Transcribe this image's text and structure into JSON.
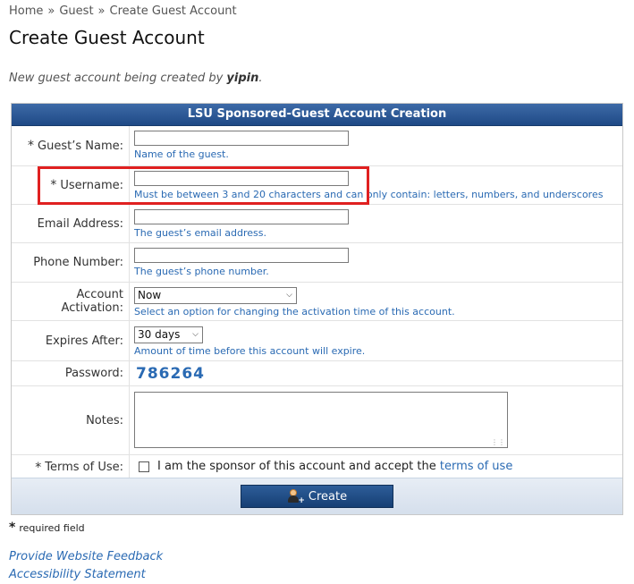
{
  "breadcrumb": [
    "Home",
    "Guest",
    "Create Guest Account"
  ],
  "breadcrumb_separator": "»",
  "page_title": "Create Guest Account",
  "subtitle": {
    "prefix": "New guest account being created by ",
    "user": "yipin",
    "suffix": "."
  },
  "form": {
    "header": "LSU Sponsored-Guest Account Creation",
    "required_marker": "*",
    "fields": {
      "guest_name": {
        "label": "Guest’s Name:",
        "value": "",
        "hint": "Name of the guest."
      },
      "username": {
        "label": "Username:",
        "value": "",
        "hint": "Must be between 3 and 20 characters and can only contain: letters, numbers, and underscores"
      },
      "email": {
        "label": "Email Address:",
        "value": "",
        "hint": "The guest’s email address."
      },
      "phone": {
        "label": "Phone Number:",
        "value": "",
        "hint": "The guest’s phone number."
      },
      "activation": {
        "label": "Account Activation:",
        "value": "Now",
        "hint": "Select an option for changing the activation time of this account."
      },
      "expires": {
        "label": "Expires After:",
        "value": "30 days",
        "hint": "Amount of time before this account will expire."
      },
      "password": {
        "label": "Password:",
        "value": "786264"
      },
      "notes": {
        "label": "Notes:",
        "value": ""
      },
      "terms": {
        "label": "Terms of Use:",
        "checked": false,
        "text": "I am the sponsor of this account and accept the ",
        "link": "terms of use"
      }
    },
    "create_button": "Create"
  },
  "required_note": {
    "star": "*",
    "text": "required field"
  },
  "footer_links": [
    "Provide Website Feedback",
    "Accessibility Statement"
  ],
  "colors": {
    "header": "#1f4a86",
    "link": "#2a6ab3",
    "highlight": "#e02020"
  }
}
